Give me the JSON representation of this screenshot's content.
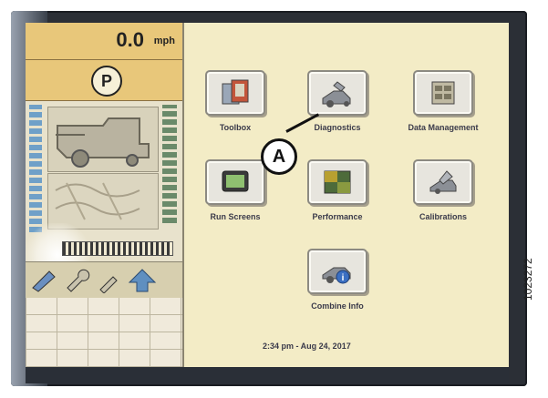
{
  "status": {
    "speed_value": "0.0",
    "speed_unit": "mph",
    "park_label": "P"
  },
  "menu": {
    "items": [
      {
        "label": "Toolbox",
        "icon": "toolbox-icon"
      },
      {
        "label": "Diagnostics",
        "icon": "diagnostics-icon"
      },
      {
        "label": "Data Management",
        "icon": "data-management-icon"
      },
      {
        "label": "Run Screens",
        "icon": "run-screens-icon"
      },
      {
        "label": "Performance",
        "icon": "performance-icon"
      },
      {
        "label": "Calibrations",
        "icon": "calibrations-icon"
      },
      {
        "label": "Combine Info",
        "icon": "combine-info-icon"
      }
    ]
  },
  "footer": {
    "datetime": "2:34 pm - Aug 24, 2017"
  },
  "callout": {
    "label": "A"
  },
  "figure_id": "1023272",
  "colors": {
    "screen_bg": "#f3ecc6",
    "status_yellow": "#e8c77a",
    "bezel": "#2b2f36",
    "accent_blue": "#5f8fc0"
  }
}
